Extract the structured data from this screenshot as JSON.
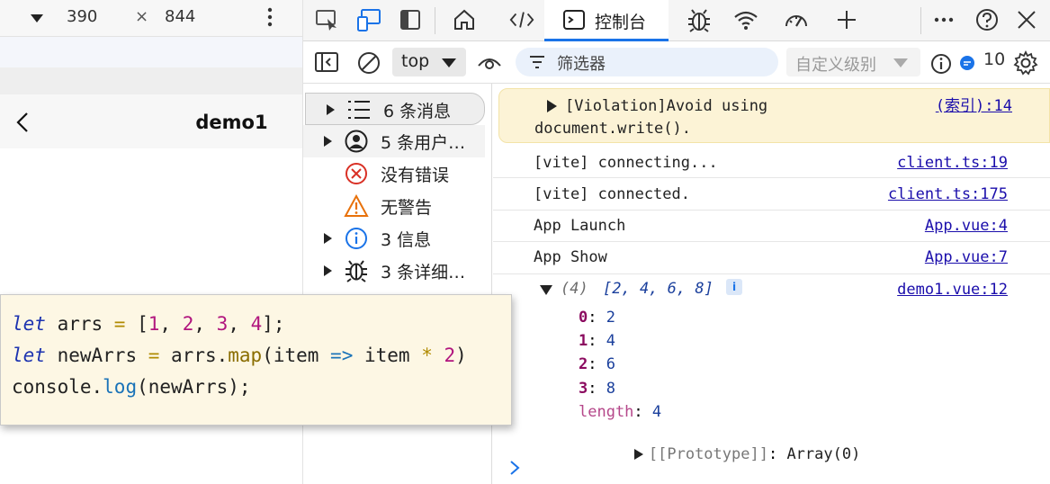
{
  "device_toolbar": {
    "width": "390",
    "times": "×",
    "height": "844"
  },
  "page": {
    "nav_title": "demo1"
  },
  "devtools": {
    "tabs": [
      {
        "name": "inspect-tool",
        "icon": "inspect-icon"
      },
      {
        "name": "device-emulation",
        "icon": "device-icon"
      },
      {
        "name": "dock-toggle",
        "icon": "panel-icon"
      },
      {
        "name": "welcome",
        "icon": "home-icon"
      },
      {
        "name": "elements",
        "icon": "code-icon"
      },
      {
        "name": "console",
        "icon": "console-icon",
        "label": "控制台",
        "active": true
      },
      {
        "name": "sources",
        "icon": "bug-icon"
      },
      {
        "name": "network",
        "icon": "wifi-icon"
      },
      {
        "name": "performance",
        "icon": "gauge-icon"
      },
      {
        "name": "add-tool",
        "icon": "plus-icon"
      }
    ],
    "console_tab_label": "控制台",
    "toolbar": {
      "context": "top",
      "filter_placeholder": "筛选器",
      "levels": "自定义级别",
      "issues_count": "10"
    },
    "sidebar": [
      {
        "label": "6 条消息",
        "icon": "list-icon",
        "expandable": true,
        "selected": true
      },
      {
        "label": "5 条用户…",
        "icon": "user-icon",
        "expandable": true
      },
      {
        "label": "没有错误",
        "icon": "error-icon",
        "expandable": false
      },
      {
        "label": "无警告",
        "icon": "warning-icon",
        "expandable": false
      },
      {
        "label": "3 信息",
        "icon": "info-icon",
        "expandable": true
      },
      {
        "label": "3 条详细…",
        "icon": "bug-icon",
        "expandable": true
      }
    ],
    "messages": [
      {
        "text_line1": "[Violation]Avoid using",
        "text_line2": "document.write().",
        "source": "(索引):14",
        "level": "violation"
      },
      {
        "text": "[vite] connecting...",
        "source": "client.ts:19"
      },
      {
        "text": "[vite] connected.",
        "source": "client.ts:175"
      },
      {
        "text": "App Launch",
        "source": "App.vue:4"
      },
      {
        "text": "App Show",
        "source": "App.vue:7"
      }
    ],
    "array_log": {
      "count": "(4)",
      "preview": "[2, 4, 6, 8]",
      "info_badge": "i",
      "source": "demo1.vue:12",
      "entries": [
        {
          "key": "0",
          "value": "2"
        },
        {
          "key": "1",
          "value": "4"
        },
        {
          "key": "2",
          "value": "6"
        },
        {
          "key": "3",
          "value": "8"
        }
      ],
      "length_key": "length",
      "length_value": "4",
      "prototype_label": "[[Prototype]]",
      "prototype_value": "Array(0)"
    }
  },
  "code_snippet": {
    "line1": {
      "kw": "let",
      "name": " arrs ",
      "op": "=",
      "open": " [",
      "n1": "1",
      "n2": "2",
      "n3": "3",
      "n4": "4",
      "close": "];"
    },
    "line2": {
      "kw": "let",
      "name": " newArrs ",
      "op": "=",
      "obj": " arrs.",
      "method": "map",
      "args_open": "(item ",
      "arrow": "=>",
      "args_mid": " item ",
      "mul": "*",
      "num": " 2",
      "args_close": ")"
    },
    "line3": {
      "obj": "console.",
      "method": "log",
      "args": "(newArrs);"
    }
  },
  "colors": {
    "accent": "#1a73e8",
    "violation_bg": "#fcf3d6",
    "code_bg": "#fdf7e4",
    "link": "#1a0dab"
  }
}
